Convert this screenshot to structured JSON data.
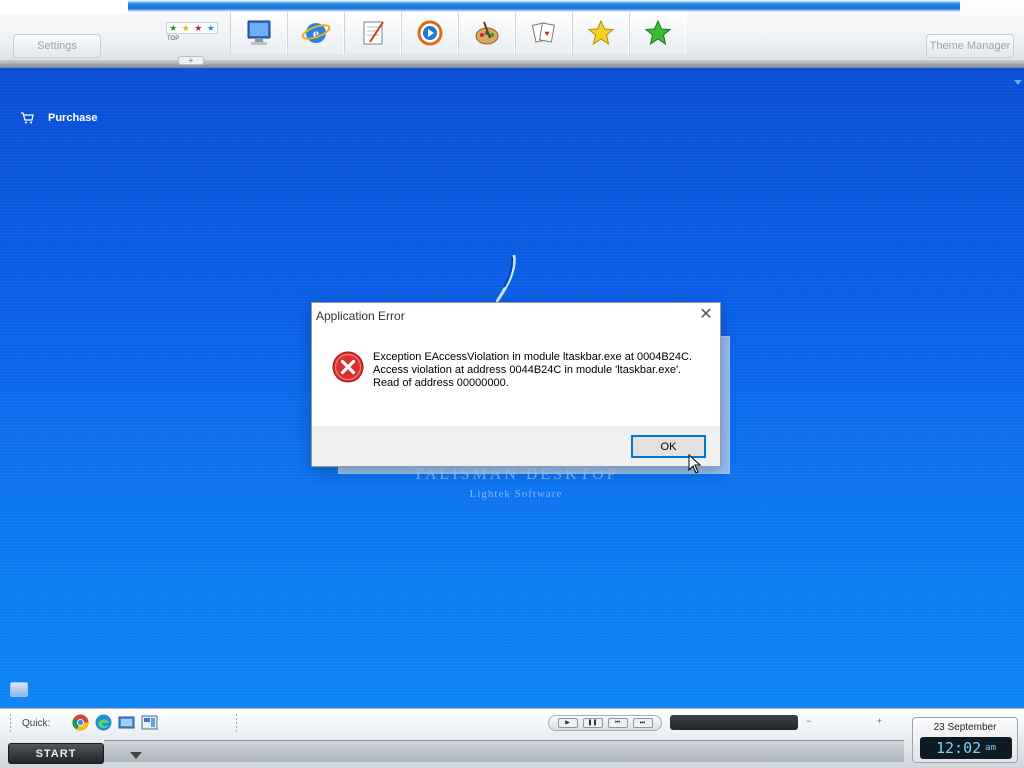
{
  "topbar": {
    "settings_label": "Settings",
    "theme_manager_label": "Theme Manager",
    "top_label": "TOP",
    "plus_label": "+",
    "launcher_icons": [
      "computer-icon",
      "internet-explorer-icon",
      "notepad-icon",
      "media-player-icon",
      "paint-icon",
      "solitaire-icon",
      "favorites-star-icon",
      "green-star-icon"
    ]
  },
  "desktop": {
    "purchase_label": "Purchase",
    "watermark_title": "TALISMAN DESKTOP",
    "watermark_subtitle": "Lightek Software"
  },
  "dialog": {
    "title": "Application Error",
    "close_glyph": "✕",
    "message_line1": "Exception EAccessViolation in module ltaskbar.exe at 0004B24C.",
    "message_line2": "Access violation at address 0044B24C in module 'ltaskbar.exe'.",
    "message_line3": "Read of address 00000000.",
    "ok_label": "OK"
  },
  "taskbar": {
    "quick_label": "Quick:",
    "start_label": "START",
    "media_buttons": [
      "▶",
      "❚❚",
      "⏮",
      "⏭"
    ],
    "volume_minus": "−",
    "volume_plus": "+",
    "date": "23 September",
    "time": "12:02",
    "ampm": "am",
    "quick_icons": [
      "chrome-icon",
      "edge-icon",
      "network-icon",
      "control-panel-icon"
    ]
  },
  "colors": {
    "desktop_blue": "#0b63ec",
    "error_red": "#d9312e",
    "ok_border": "#0078d7"
  }
}
